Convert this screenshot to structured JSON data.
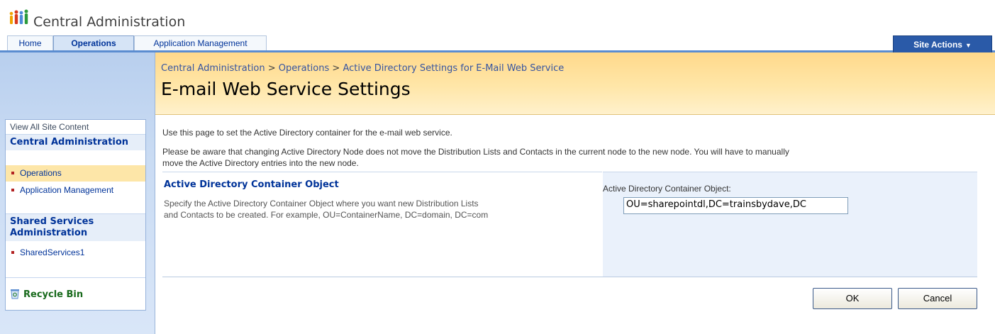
{
  "app": {
    "title": "Central Administration"
  },
  "tabs": [
    {
      "label": "Home",
      "selected": false
    },
    {
      "label": "Operations",
      "selected": true
    },
    {
      "label": "Application Management",
      "selected": false
    }
  ],
  "site_actions": {
    "label": "Site Actions",
    "icon": "chevron-down-icon"
  },
  "leftnav": {
    "view_all": "View All Site Content",
    "sections": [
      {
        "heading": "Central Administration",
        "items": [
          "Operations",
          "Application Management"
        ],
        "selected": "Operations"
      },
      {
        "heading": "Shared Services Administration",
        "items": [
          "SharedServices1"
        ]
      }
    ],
    "recycle_bin": "Recycle Bin"
  },
  "header": {
    "breadcrumb": [
      "Central Administration",
      "Operations",
      "Active Directory Settings for E-Mail Web Service"
    ],
    "breadcrumb_sep": ">",
    "title": "E-mail Web Service Settings"
  },
  "main": {
    "intro": "Use this page to set the Active Directory container for the e-mail web service.",
    "warning_line1": "Please be aware that changing Active Directory Node does not move the Distribution Lists and Contacts in the current node to the new node. You will have to manually",
    "warning_line2": "move the Active Directory entries into the new node.",
    "section": {
      "heading": "Active Directory Container Object",
      "desc_line1": "Specify the Active Directory Container Object where you want new Distribution Lists",
      "desc_line2": "and Contacts to be created. For example, OU=ContainerName, DC=domain, DC=com",
      "field_label": "Active Directory Container Object:",
      "field_value": "OU=sharepointdl,DC=trainsbydave,DC"
    },
    "buttons": {
      "ok": "OK",
      "cancel": "Cancel"
    }
  },
  "colors": {
    "accent": "#003399",
    "header_band": "#ffe6a8",
    "site_actions": "#2a5aa8",
    "recycle": "#186a1c"
  }
}
